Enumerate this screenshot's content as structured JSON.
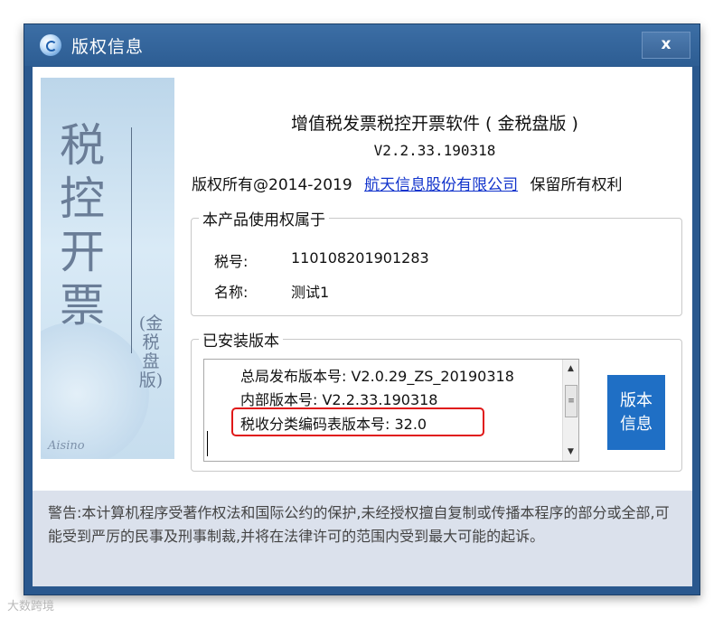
{
  "window": {
    "title": "版权信息",
    "close_label": "x"
  },
  "banner": {
    "big_text": "税控开票",
    "small_text": "(金税盘版)",
    "en_text": "Aisino"
  },
  "product": {
    "name": "增值税发票税控开票软件 ( 金税盘版 )",
    "version": "V2.2.33.190318",
    "copyright_prefix": "版权所有@2014-2019",
    "company_link": "航天信息股份有限公司",
    "rights": "保留所有权利"
  },
  "license_group": {
    "legend": "本产品使用权属于",
    "tax_id_label": "税号:",
    "tax_id_value": "110108201901283",
    "name_label": "名称:",
    "name_value": "测试1"
  },
  "installed_group": {
    "legend": "已安装版本",
    "lines": [
      "总局发布版本号: V2.0.29_ZS_20190318",
      "内部版本号: V2.2.33.190318",
      "税收分类编码表版本号: 32.0"
    ],
    "version_button_label": "版本信息"
  },
  "warning": {
    "text": "警告:本计算机程序受著作权法和国际公约的保护,未经授权擅自复制或传播本程序的部分或全部,可能受到严厉的民事及刑事制裁,并将在法律许可的范围内受到最大可能的起诉。"
  },
  "watermark": {
    "text": "大数跨境"
  }
}
